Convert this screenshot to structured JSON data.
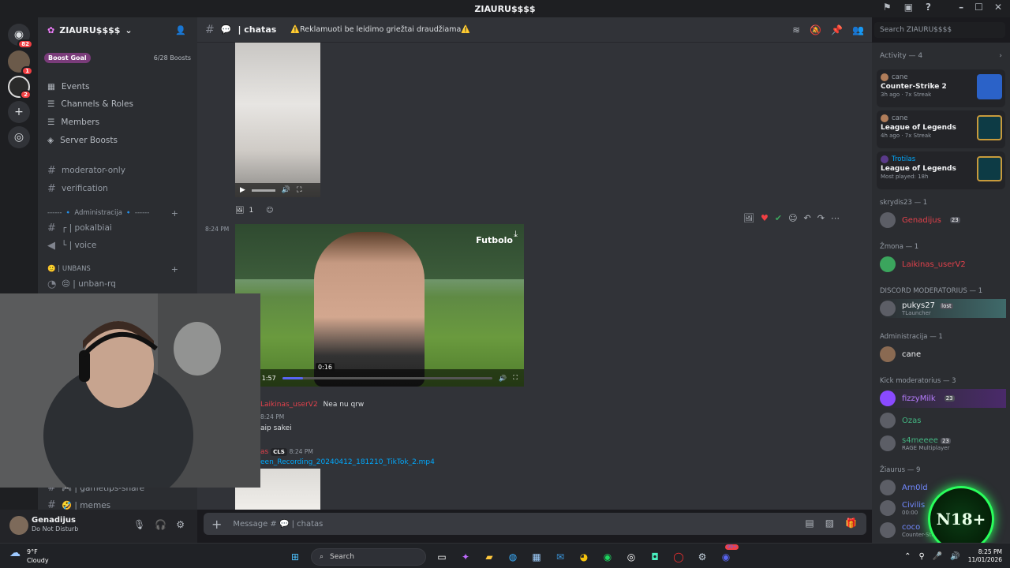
{
  "window": {
    "title": "ZIAURU$$$$"
  },
  "server": {
    "name": "ZIAURU$$$$",
    "boost_goal_label": "Boost Goal",
    "boost_count": "6/28 Boosts"
  },
  "rail": {
    "home_badge": "82",
    "srv1_badge": "1",
    "srv2_badge": "2"
  },
  "menu": [
    {
      "label": "Events"
    },
    {
      "label": "Channels & Roles"
    },
    {
      "label": "Members"
    },
    {
      "label": "Server Boosts"
    }
  ],
  "channels": {
    "moderator_only": "moderator-only",
    "verification": "verification",
    "admin_category": "------ 🔹 Administracija 🔹 ------",
    "pokalbiai": "┌ | pokalbiai",
    "voice": "└ | voice",
    "unbans_category": "🙂 | UNBANS",
    "unban_rq": "😔 | unban-rq",
    "gametips": "🎮 | gametips-share",
    "memes": "🤣 | memes"
  },
  "user": {
    "name": "Genadijus",
    "status": "Do Not Disturb"
  },
  "chat_header": {
    "channel": "| chatas",
    "topic": "⚠️Reklamuoti be leidimo griežtai draudžiama⚠️"
  },
  "search": {
    "placeholder": "Search ZIAURU$$$$"
  },
  "messages": {
    "reaction_count": "1",
    "time_1": "8:24 PM",
    "video2_title": "Futbolo",
    "video2_time": "0:11 / 1:57",
    "video2_hover_time": "0:16",
    "video2_progress": 0.097,
    "msg1_author": "Laikinas_userV2",
    "msg1_text": "Nea nu qrw",
    "time_2": "8:24 PM",
    "msg2_text": "aip sakei",
    "msg3_author": "as",
    "msg3_tag": "CLS",
    "time_3": "8:24 PM",
    "msg3_file": "een_Recording_20240412_181210_TikTok_2.mp4"
  },
  "composer": {
    "placeholder": "Message # 💬 | chatas"
  },
  "activity": {
    "header": "Activity — 4",
    "cards": [
      {
        "user": "cane",
        "game": "Counter-Strike 2",
        "meta": "3h ago · 7x Streak",
        "color": "#2b62c8"
      },
      {
        "user": "cane",
        "game": "League of Legends",
        "meta": "4h ago · 7x Streak",
        "color": "#0d3b45"
      },
      {
        "user": "Trotilas",
        "game": "League of Legends",
        "meta": "Most played: 18h",
        "color": "#0d3b45"
      }
    ]
  },
  "members": {
    "roles": [
      {
        "header": "skrydis23 — 1",
        "members": [
          {
            "name": "Genadijus",
            "boost": "23",
            "color": "#e2414b"
          }
        ]
      },
      {
        "header": "Žmona — 1",
        "members": [
          {
            "name": "Laikinas_userV2",
            "color": "#e2414b"
          }
        ]
      },
      {
        "header": "DISCORD MODERATORIUS — 1",
        "members": [
          {
            "name": "pukys27",
            "sub": "TLauncher",
            "tag": "lost",
            "color": "#f2f3f5"
          }
        ]
      },
      {
        "header": "Administracija — 1",
        "members": [
          {
            "name": "cane",
            "color": "#f2f3f5"
          }
        ]
      },
      {
        "header": "Kick moderatorius — 3",
        "members": [
          {
            "name": "fizzyMilk",
            "boost": "23",
            "color": "#b77cff"
          },
          {
            "name": "Ozas",
            "color": "#43b581"
          },
          {
            "name": "s4meeee",
            "boost": "23",
            "sub": "RAGE Multiplayer",
            "color": "#43b581"
          }
        ]
      },
      {
        "header": "Žiaurus — 9",
        "members": [
          {
            "name": "Arn0ld",
            "color": "#7289ff"
          },
          {
            "name": "Civilis",
            "sub": "00:00",
            "color": "#7289ff"
          },
          {
            "name": "coco",
            "sub": "Counter-Strike 2",
            "color": "#7289ff"
          }
        ]
      }
    ]
  },
  "overlay": {
    "badge": "N18+"
  },
  "taskbar": {
    "temp": "9°F",
    "weather": "Cloudy",
    "search": "Search",
    "time": "8:25 PM",
    "date": "11/01/2026",
    "discord_badge": "99+"
  },
  "colors": {
    "accent": "#5865f2",
    "danger": "#f23f43",
    "overlay_green": "#29ff5c"
  }
}
